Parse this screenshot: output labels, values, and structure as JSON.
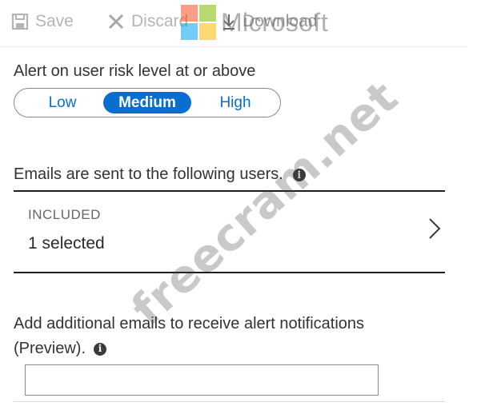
{
  "toolbar": {
    "save_label": "Save",
    "discard_label": "Discard",
    "download_label": "Download"
  },
  "logo": {
    "word": "Microsoft",
    "colors": [
      "#f25022",
      "#7fba00",
      "#00a4ef",
      "#ffb900"
    ]
  },
  "risk": {
    "label": "Alert on user risk level at or above",
    "options": [
      "Low",
      "Medium",
      "High"
    ],
    "selected": "Medium"
  },
  "emails": {
    "label": "Emails are sent to the following users.",
    "info_icon": "info-icon",
    "included_title": "INCLUDED",
    "included_value": "1 selected"
  },
  "additional": {
    "label": "Add additional emails to receive alert notifications (Preview).",
    "input_value": ""
  },
  "watermark": "freecram.net",
  "colors": {
    "accent": "#0a6ed1",
    "toolbar_text": "#b4b4b4"
  }
}
